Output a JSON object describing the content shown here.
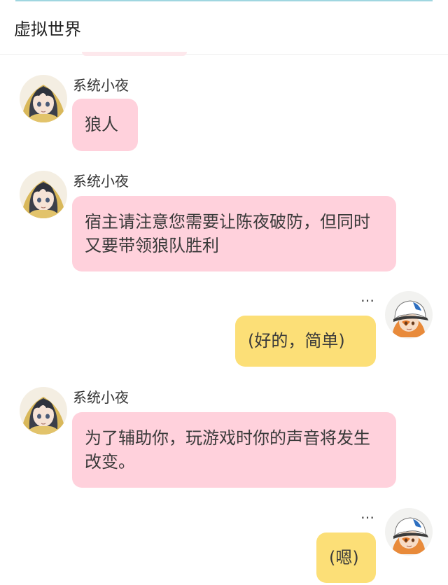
{
  "header": {
    "title": "虚拟世界"
  },
  "messages": [
    {
      "sender": "系统小夜",
      "side": "left",
      "text": "狼人"
    },
    {
      "sender": "系统小夜",
      "side": "left",
      "text": "宿主请注意您需要让陈夜破防，但同时又要带领狼队胜利"
    },
    {
      "sender": "…",
      "side": "right",
      "text": "(好的，简单)"
    },
    {
      "sender": "系统小夜",
      "side": "left",
      "text": "为了辅助你，玩游戏时你的声音将发生改变。"
    },
    {
      "sender": "…",
      "side": "right",
      "text": "(嗯)"
    }
  ],
  "colors": {
    "left_bubble": "#ffd1dc",
    "right_bubble": "#fcdf77",
    "header_accent": "#9fd6e0"
  },
  "icons": {
    "left_avatar": "anime-girl-dark-hair-avatar",
    "right_avatar": "anime-boy-white-cap-avatar"
  }
}
